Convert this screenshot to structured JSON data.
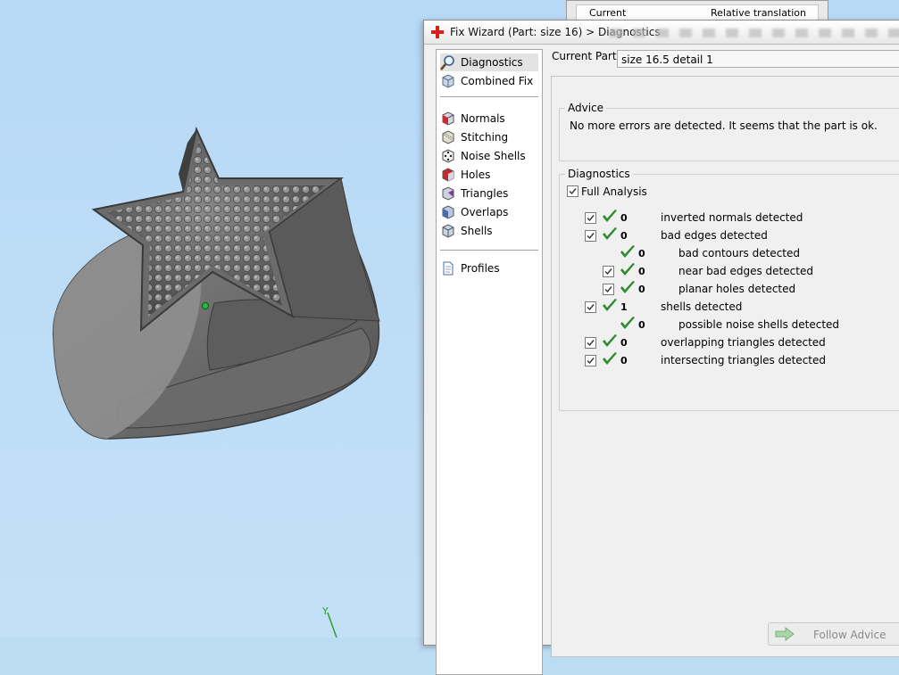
{
  "background_panel": {
    "col_current": "Current",
    "col_relative": "Relative translation"
  },
  "wizard": {
    "title": "Fix Wizard (Part: size 16) > Diagnostics",
    "current_part_label": "Current Part:",
    "current_part_value": "size 16.5 detail 1",
    "sidebar": {
      "items": [
        {
          "label": "Diagnostics",
          "icon": "magnifier-icon"
        },
        {
          "label": "Combined Fix",
          "icon": "cube-icon"
        },
        {
          "label": "Normals",
          "icon": "normals-cube-icon"
        },
        {
          "label": "Stitching",
          "icon": "stitching-cube-icon"
        },
        {
          "label": "Noise Shells",
          "icon": "dice-icon"
        },
        {
          "label": "Holes",
          "icon": "holes-cube-icon"
        },
        {
          "label": "Triangles",
          "icon": "triangles-cube-icon"
        },
        {
          "label": "Overlaps",
          "icon": "overlaps-cube-icon"
        },
        {
          "label": "Shells",
          "icon": "shells-cube-icon"
        },
        {
          "label": "Profiles",
          "icon": "document-icon"
        }
      ]
    },
    "advice": {
      "title": "Advice",
      "text": "No more errors are detected. It seems that the part is ok."
    },
    "diagnostics": {
      "title": "Diagnostics",
      "full_analysis": "Full Analysis",
      "rows": [
        {
          "count": "0",
          "label": "inverted normals detected"
        },
        {
          "count": "0",
          "label": "bad edges detected"
        },
        {
          "count": "0",
          "label": "bad contours detected"
        },
        {
          "count": "0",
          "label": "near bad edges detected"
        },
        {
          "count": "0",
          "label": "planar holes detected"
        },
        {
          "count": "1",
          "label": "shells detected"
        },
        {
          "count": "0",
          "label": "possible noise shells detected"
        },
        {
          "count": "0",
          "label": "overlapping triangles detected"
        },
        {
          "count": "0",
          "label": "intersecting triangles detected"
        }
      ]
    },
    "follow_advice": "Follow Advice"
  },
  "colors": {
    "viewport": "#bcdcf4",
    "check_green": "#2f8a2f",
    "title_icon_red": "#d62020"
  }
}
